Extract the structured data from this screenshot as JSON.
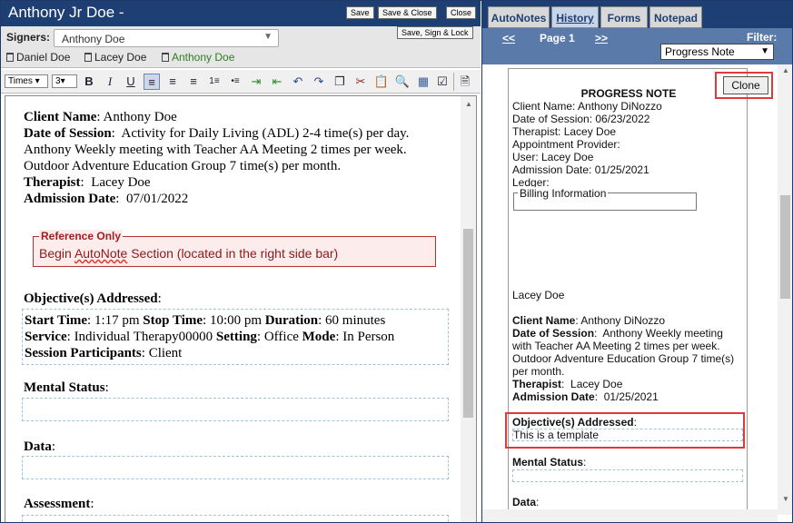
{
  "window": {
    "title": "Anthony Jr Doe -"
  },
  "toolbar_buttons": {
    "save": "Save",
    "save_close": "Save & Close",
    "close": "Close",
    "save_sign_lock": "Save, Sign & Lock"
  },
  "signers": {
    "label": "Signers:",
    "selected": "Anthony Doe",
    "list": [
      {
        "name": "Daniel Doe",
        "color": "#222222"
      },
      {
        "name": "Lacey Doe",
        "color": "#222222"
      },
      {
        "name": "Anthony Doe",
        "color": "#2e7d1e"
      }
    ]
  },
  "editor_toolbar": {
    "font": "Times",
    "size": "3"
  },
  "editor": {
    "client_name_label": "Client Name",
    "client_name": "Anthony Doe",
    "dos_label": "Date of Session",
    "dos_text": "Activity for Daily Living (ADL) 2-4 time(s) per day.  Anthony Weekly meeting with Teacher  AA Meeting 2 times per week.  Outdoor Adventure Education Group 7 time(s) per month.",
    "therapist_label": "Therapist",
    "therapist": "Lacey Doe",
    "admission_label": "Admission Date",
    "admission": "07/01/2022",
    "ref_label": "Reference Only",
    "ref_text_1": "Begin ",
    "ref_text_autonote": "AutoNote",
    "ref_text_2": " Section (located in the right side bar)",
    "objectives_label": "Objective(s) Addressed",
    "start_label": "Start Time",
    "start": "1:17 pm",
    "stop_label": "Stop Time",
    "stop": "10:00 pm",
    "duration_label": "Duration",
    "duration": "60 minutes",
    "service_label": "Service",
    "service": "Individual Therapy00000",
    "setting_label": "Setting",
    "setting": "Office",
    "mode_label": "Mode",
    "mode": "In Person",
    "participants_label": "Session Participants",
    "participants": "Client",
    "mental_label": "Mental Status",
    "data_label": "Data",
    "assessment_label": "Assessment"
  },
  "side_tabs": [
    "AutoNotes",
    "History",
    "Forms",
    "Notepad"
  ],
  "active_tab": "History",
  "history_nav": {
    "prev": "<<",
    "page": "Page 1",
    "next": ">>",
    "filter_label": "Filter:",
    "filter_value": "Progress Note"
  },
  "note": {
    "clone": "Clone",
    "title": "PROGRESS NOTE",
    "lines": [
      "Client Name: Anthony DiNozzo",
      "Date of Session: 06/23/2022",
      "Therapist: Lacey Doe",
      "Appointment Provider:",
      "User: Lacey Doe",
      "Admission Date: 01/25/2021",
      "Ledger:"
    ],
    "billing_label": "Billing Information",
    "signer": "Lacey Doe",
    "client_name_label": "Client Name",
    "client_name": "Anthony DiNozzo",
    "dos_label": "Date of Session",
    "dos_text": "Anthony Weekly meeting with Teacher  AA Meeting 2 times per week.  Outdoor Adventure Education Group 7 time(s) per month.",
    "therapist_label": "Therapist",
    "therapist": "Lacey Doe",
    "admission_label": "Admission Date",
    "admission": "01/25/2021",
    "objectives_label": "Objective(s) Addressed",
    "objectives_text": "This is a template",
    "mental_label": "Mental Status",
    "data_label": "Data"
  }
}
